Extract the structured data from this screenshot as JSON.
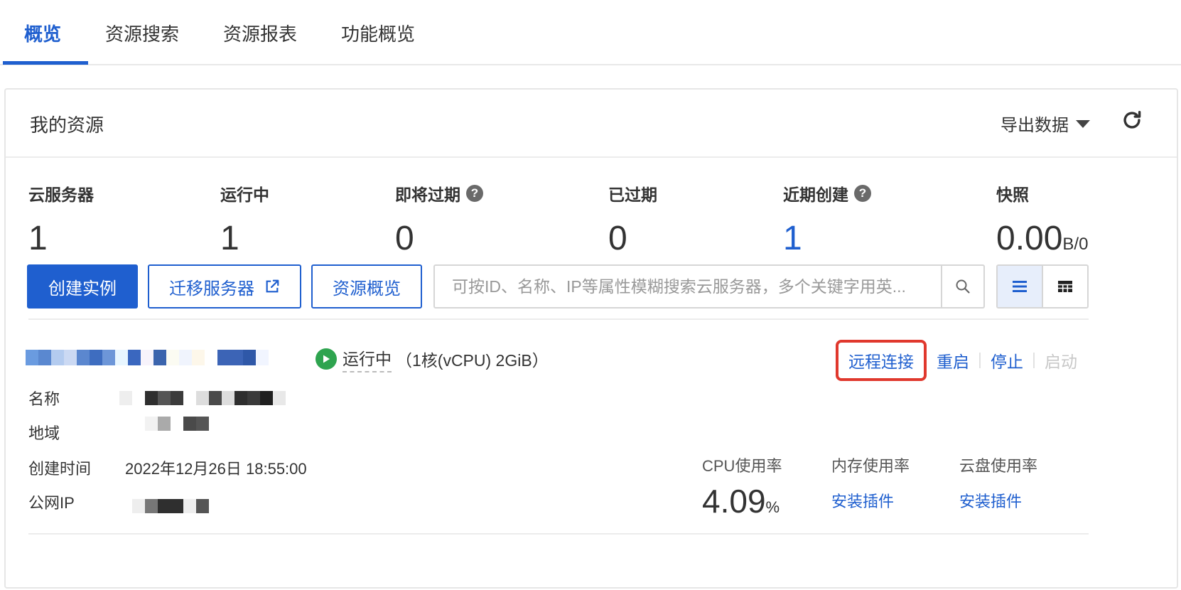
{
  "tabs": [
    "概览",
    "资源搜索",
    "资源报表",
    "功能概览"
  ],
  "card": {
    "title": "我的资源",
    "export_label": "导出数据"
  },
  "stats": [
    {
      "label": "云服务器",
      "value": "1"
    },
    {
      "label": "运行中",
      "value": "1"
    },
    {
      "label": "即将过期",
      "value": "0"
    },
    {
      "label": "已过期",
      "value": "0"
    },
    {
      "label": "近期创建",
      "value": "1"
    },
    {
      "label": "快照",
      "value": "0.00",
      "unit": "B/0"
    }
  ],
  "actions": {
    "create": "创建实例",
    "migrate": "迁移服务器",
    "overview": "资源概览",
    "search_placeholder": "可按ID、名称、IP等属性模糊搜索云服务器，多个关键字用英..."
  },
  "instance": {
    "status": "运行中",
    "spec": "（1核(vCPU) 2GiB）",
    "ops": {
      "remote": "远程连接",
      "restart": "重启",
      "stop": "停止",
      "start": "启动"
    },
    "fields": {
      "name_label": "名称",
      "region_label": "地域",
      "created_label": "创建时间",
      "created_value": "2022年12月26日 18:55:00",
      "ip_label": "公网IP"
    },
    "metrics": {
      "cpu_label": "CPU使用率",
      "cpu_value": "4.09",
      "cpu_unit": "%",
      "mem_label": "内存使用率",
      "mem_action": "安装插件",
      "disk_label": "云盘使用率",
      "disk_action": "安装插件"
    }
  },
  "colors": {
    "accent": "#1f5fcf",
    "running": "#2ea44f",
    "highlight": "#e0382d"
  }
}
